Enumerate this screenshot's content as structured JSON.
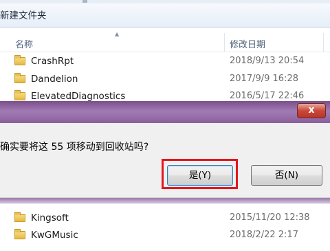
{
  "toolbar": {
    "new_folder_label": "新建文件夹"
  },
  "columns": {
    "name": "名称",
    "date_modified": "修改日期"
  },
  "files_top": [
    {
      "name": "CrashRpt",
      "date": "2018/9/13 20:54"
    },
    {
      "name": "Dandelion",
      "date": "2017/9/9 16:28"
    },
    {
      "name": "ElevatedDiagnostics",
      "date": "2016/5/17 22:46"
    }
  ],
  "files_bottom": [
    {
      "name": "Kingsoft",
      "date": "2015/11/20 12:38"
    },
    {
      "name": "KwGMusic",
      "date": "2018/2/22 2:17"
    }
  ],
  "dialog": {
    "message": "确实要将这 55 项移动到回收站吗?",
    "yes_label": "是(Y)",
    "no_label": "否(N)",
    "close_label": "x"
  },
  "colors": {
    "dialog_title": "#8a5f9c",
    "highlight": "#e8141c",
    "close_button": "#c9483a"
  }
}
